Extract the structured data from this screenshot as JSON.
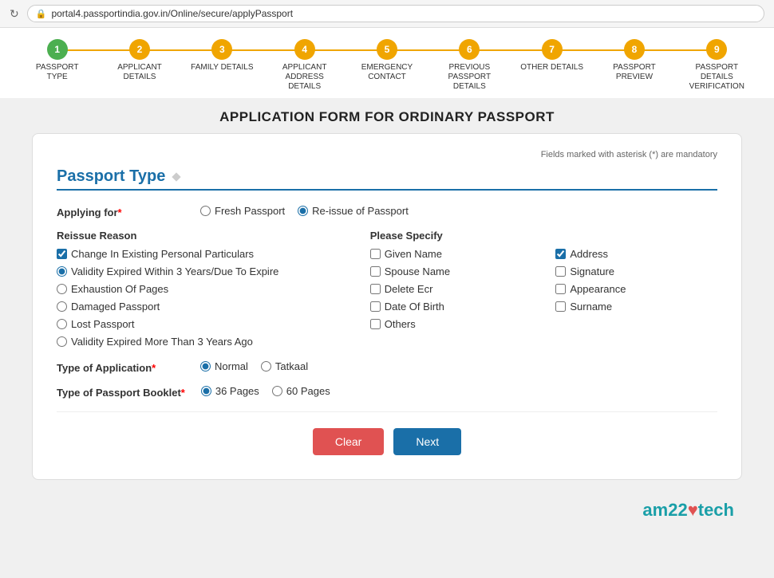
{
  "browser": {
    "url": "portal4.passportindia.gov.in/Online/secure/applyPassport"
  },
  "steps": [
    {
      "number": "1",
      "label": "PASSPORT TYPE",
      "state": "active"
    },
    {
      "number": "2",
      "label": "APPLICANT DETAILS",
      "state": "pending"
    },
    {
      "number": "3",
      "label": "FAMILY DETAILS",
      "state": "pending"
    },
    {
      "number": "4",
      "label": "APPLICANT ADDRESS DETAILS",
      "state": "pending"
    },
    {
      "number": "5",
      "label": "EMERGENCY CONTACT",
      "state": "pending"
    },
    {
      "number": "6",
      "label": "PREVIOUS PASSPORT DETAILS",
      "state": "pending"
    },
    {
      "number": "7",
      "label": "OTHER DETAILS",
      "state": "pending"
    },
    {
      "number": "8",
      "label": "PASSPORT PREVIEW",
      "state": "pending"
    },
    {
      "number": "9",
      "label": "PASSPORT DETAILS VERIFICATION",
      "state": "pending"
    }
  ],
  "page": {
    "title": "APPLICATION FORM FOR ORDINARY PASSPORT"
  },
  "form": {
    "mandatory_note": "Fields marked with asterisk (*) are mandatory",
    "section_title": "Passport Type",
    "applying_for_label": "Applying for",
    "applying_for_options": [
      {
        "value": "fresh",
        "label": "Fresh Passport",
        "checked": false
      },
      {
        "value": "reissue",
        "label": "Re-issue of Passport",
        "checked": true
      }
    ],
    "reissue_reason_label": "Reissue Reason",
    "reissue_reasons": [
      {
        "value": "change_personal",
        "label": "Change In Existing Personal Particulars",
        "checked": true,
        "type": "checkbox"
      },
      {
        "value": "validity_expired_3",
        "label": "Validity Expired Within 3 Years/Due To Expire",
        "checked": true,
        "type": "radio"
      },
      {
        "value": "exhaustion",
        "label": "Exhaustion Of Pages",
        "checked": false,
        "type": "radio"
      },
      {
        "value": "damaged",
        "label": "Damaged Passport",
        "checked": false,
        "type": "radio"
      },
      {
        "value": "lost",
        "label": "Lost Passport",
        "checked": false,
        "type": "radio"
      },
      {
        "value": "validity_expired_more",
        "label": "Validity Expired More Than 3 Years Ago",
        "checked": false,
        "type": "radio"
      }
    ],
    "please_specify_label": "Please Specify",
    "specify_options": [
      {
        "value": "given_name",
        "label": "Given Name",
        "checked": false
      },
      {
        "value": "address",
        "label": "Address",
        "checked": true
      },
      {
        "value": "spouse_name",
        "label": "Spouse Name",
        "checked": false
      },
      {
        "value": "signature",
        "label": "Signature",
        "checked": false
      },
      {
        "value": "delete_ecr",
        "label": "Delete Ecr",
        "checked": false
      },
      {
        "value": "appearance",
        "label": "Appearance",
        "checked": false
      },
      {
        "value": "date_of_birth",
        "label": "Date Of Birth",
        "checked": false
      },
      {
        "value": "surname",
        "label": "Surname",
        "checked": false
      },
      {
        "value": "others",
        "label": "Others",
        "checked": false
      }
    ],
    "type_of_application_label": "Type of Application",
    "application_types": [
      {
        "value": "normal",
        "label": "Normal",
        "checked": true
      },
      {
        "value": "tatkaal",
        "label": "Tatkaal",
        "checked": false
      }
    ],
    "passport_booklet_label": "Type of Passport Booklet",
    "booklet_types": [
      {
        "value": "36",
        "label": "36 Pages",
        "checked": true
      },
      {
        "value": "60",
        "label": "60 Pages",
        "checked": false
      }
    ],
    "btn_clear": "Clear",
    "btn_next": "Next"
  }
}
